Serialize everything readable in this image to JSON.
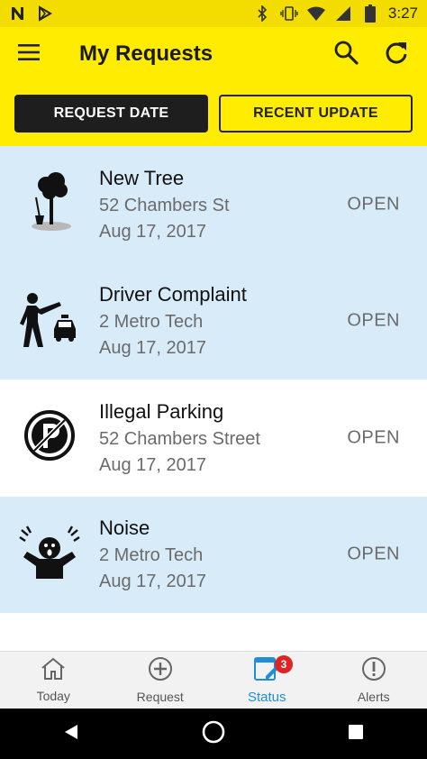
{
  "status_bar": {
    "time": "3:27",
    "left_icons": [
      "n-notification-icon",
      "play-store-icon"
    ],
    "right_icons": [
      "bluetooth-icon",
      "vibrate-icon",
      "wifi-icon",
      "signal-icon",
      "battery-icon"
    ]
  },
  "app_bar": {
    "title": "My Requests",
    "menu_icon": "hamburger-menu-icon",
    "search_icon": "search-icon",
    "refresh_icon": "refresh-icon"
  },
  "sort": {
    "request_date_label": "REQUEST DATE",
    "recent_update_label": "RECENT UPDATE",
    "selected": "REQUEST DATE"
  },
  "requests": [
    {
      "title": "New Tree",
      "address": "52 Chambers St",
      "date": "Aug 17, 2017",
      "status": "OPEN",
      "icon": "tree-planting-icon"
    },
    {
      "title": "Driver Complaint",
      "address": "2 Metro Tech",
      "date": "Aug 17, 2017",
      "status": "OPEN",
      "icon": "taxi-complaint-icon"
    },
    {
      "title": "Illegal Parking",
      "address": "52 Chambers Street",
      "date": "Aug 17, 2017",
      "status": "OPEN",
      "icon": "no-parking-icon"
    },
    {
      "title": "Noise",
      "address": "2 Metro Tech",
      "date": "Aug 17, 2017",
      "status": "OPEN",
      "icon": "noise-scream-icon"
    }
  ],
  "bottom_nav": {
    "today": "Today",
    "request": "Request",
    "status": "Status",
    "alerts": "Alerts",
    "status_badge": "3",
    "active": "Status"
  },
  "colors": {
    "brand_yellow": "#ffec00",
    "row_blue": "#d8ebf8",
    "active_blue": "#1e8fd6",
    "badge_red": "#e02424"
  }
}
